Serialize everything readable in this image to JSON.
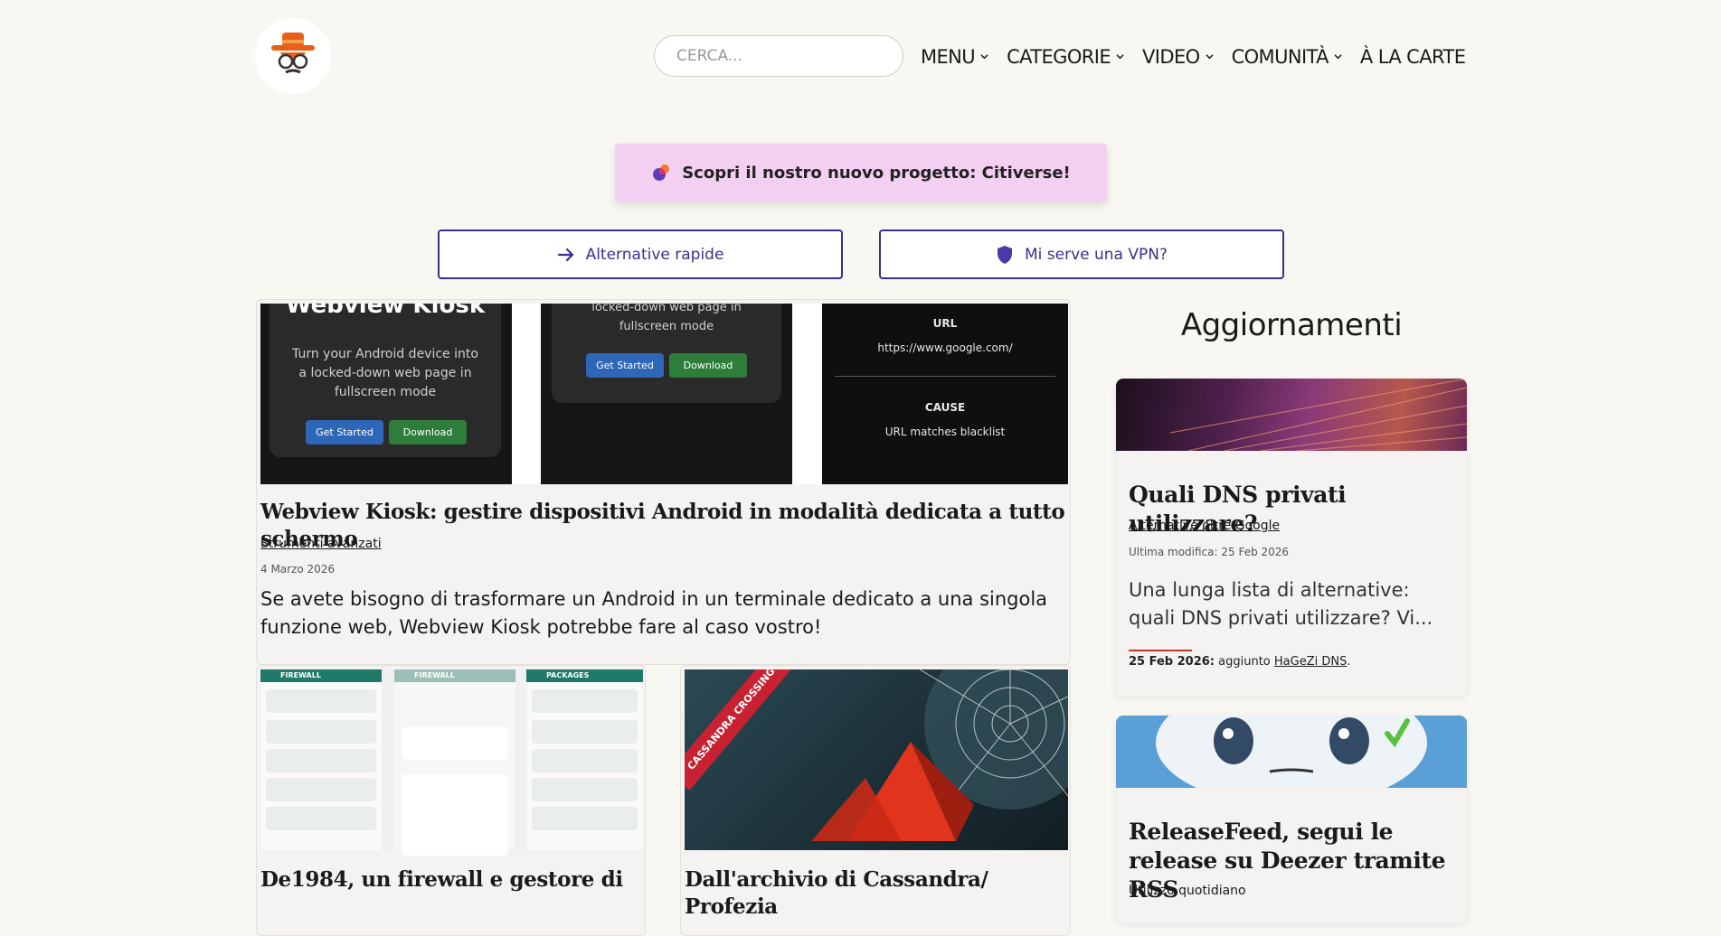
{
  "header": {
    "search_placeholder": "CERCA...",
    "nav": [
      {
        "label": "MENU",
        "has_dropdown": true
      },
      {
        "label": "CATEGORIE",
        "has_dropdown": true
      },
      {
        "label": "VIDEO",
        "has_dropdown": true
      },
      {
        "label": "COMUNITÀ",
        "has_dropdown": true
      },
      {
        "label": "À LA CARTE",
        "has_dropdown": false
      }
    ]
  },
  "banner": {
    "citiverse_label": "Scopri il nostro nuovo progetto: Citiverse!",
    "alt_button": "Alternative rapide",
    "vpn_button": "Mi serve una VPN?"
  },
  "featured": {
    "screens": {
      "s1_title": "Webview Kiosk",
      "s1_text": "Turn your Android device into a locked-down web page in fullscreen mode",
      "s2_text": "locked-down web page in fullscreen mode",
      "get_started": "Get Started",
      "download": "Download",
      "s3_url_label": "URL",
      "s3_url_value": "https://www.google.com/",
      "s3_cause_label": "CAUSE",
      "s3_cause_value": "URL matches blacklist"
    },
    "title": "Webview Kiosk: gestire dispositivi Android in modalità dedicata a tutto schermo",
    "category": "Strumenti avanzati",
    "date": "4 Marzo 2026",
    "excerpt": "Se avete bisogno di trasformare un Android in un terminale dedicato a una singola funzione web, Webview Kiosk potrebbe fare al caso vostro!"
  },
  "cards": [
    {
      "title": "De1984, un firewall e gestore di",
      "banner": [
        "FIREWALL",
        "FIREWALL",
        "PACKAGES"
      ]
    },
    {
      "title": "Dall'archivio di Cassandra/ Profezia",
      "ribbon": "CASSANDRA CROSSING"
    }
  ],
  "sidebar": {
    "heading": "Aggiornamenti",
    "items": [
      {
        "title": "Quali DNS privati utilizzare?",
        "category": "Alternative oltre Google",
        "modified": "Ultima modifica: 25 Feb 2026",
        "excerpt": "Una lunga lista di alternative: quali DNS privati utilizzare? Vi...",
        "update_date": "25 Feb 2026:",
        "update_text": " aggiunto ",
        "update_link": "HaGeZi DNS",
        "update_end": "."
      },
      {
        "title": "ReleaseFeed, segui le release su Deezer tramite RSS",
        "category": "Utilizzo quotidiano"
      }
    ]
  },
  "colors": {
    "background": "#f9f7f2",
    "accent": "#3a2f8f",
    "banner": "#f3cff1",
    "logo_orange": "#e8611a"
  }
}
